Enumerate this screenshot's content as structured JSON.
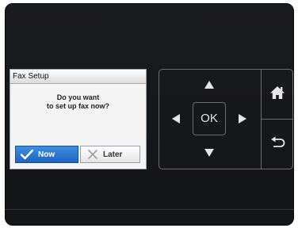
{
  "dialog": {
    "title": "Fax Setup",
    "message_line1": "Do you want",
    "message_line2": "to set up fax now?",
    "now_label": "Now",
    "later_label": "Later"
  },
  "nav": {
    "ok_label": "OK"
  },
  "colors": {
    "panel_bg": "#1a1b1e",
    "primary_button": "#1c64c0",
    "icon": "#e6e6e6"
  },
  "icons": [
    "check-icon",
    "cross-icon",
    "arrow-up-icon",
    "arrow-down-icon",
    "arrow-left-icon",
    "arrow-right-icon",
    "home-icon",
    "back-icon"
  ]
}
